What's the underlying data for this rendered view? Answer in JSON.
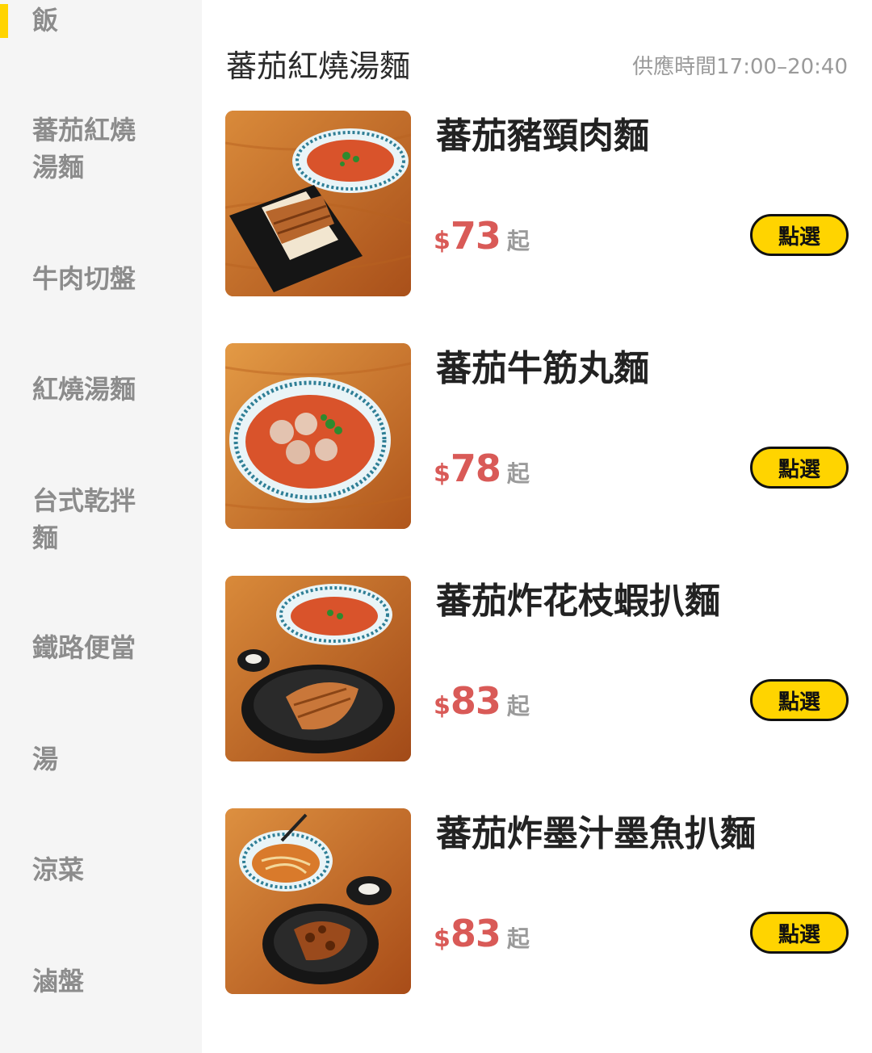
{
  "sidebar": {
    "items": [
      {
        "label": "飯",
        "active": true
      },
      {
        "label": "蕃茄紅燒湯麵"
      },
      {
        "label": "牛肉切盤"
      },
      {
        "label": "紅燒湯麵"
      },
      {
        "label": "台式乾拌麵"
      },
      {
        "label": "鐵路便當"
      },
      {
        "label": "湯"
      },
      {
        "label": "涼菜"
      },
      {
        "label": "滷盤"
      }
    ],
    "active_color": "#ffd400"
  },
  "main": {
    "section_title": "蕃茄紅燒湯麵",
    "serving_time": "供應時間17:00–20:40",
    "currency_symbol": "$",
    "from_label": "起",
    "order_label": "點選",
    "items": [
      {
        "name": "蕃茄豬頸肉麵",
        "price": "73",
        "image": "tomato-noodle-soup-with-grilled-pork-neck"
      },
      {
        "name": "蕃茄牛筋丸麵",
        "price": "78",
        "image": "tomato-noodle-soup-with-beef-tendon-balls"
      },
      {
        "name": "蕃茄炸花枝蝦扒麵",
        "price": "83",
        "image": "tomato-noodle-soup-with-fried-squid-shrimp-patty"
      },
      {
        "name": "蕃茄炸墨汁墨魚扒麵",
        "price": "83",
        "image": "tomato-noodle-soup-with-fried-squid-ink-cutlet"
      }
    ]
  },
  "colors": {
    "price": "#d95a57",
    "button": "#ffd400",
    "sidebar_bg": "#f5f5f5",
    "sidebar_text": "#8c8c8c"
  }
}
